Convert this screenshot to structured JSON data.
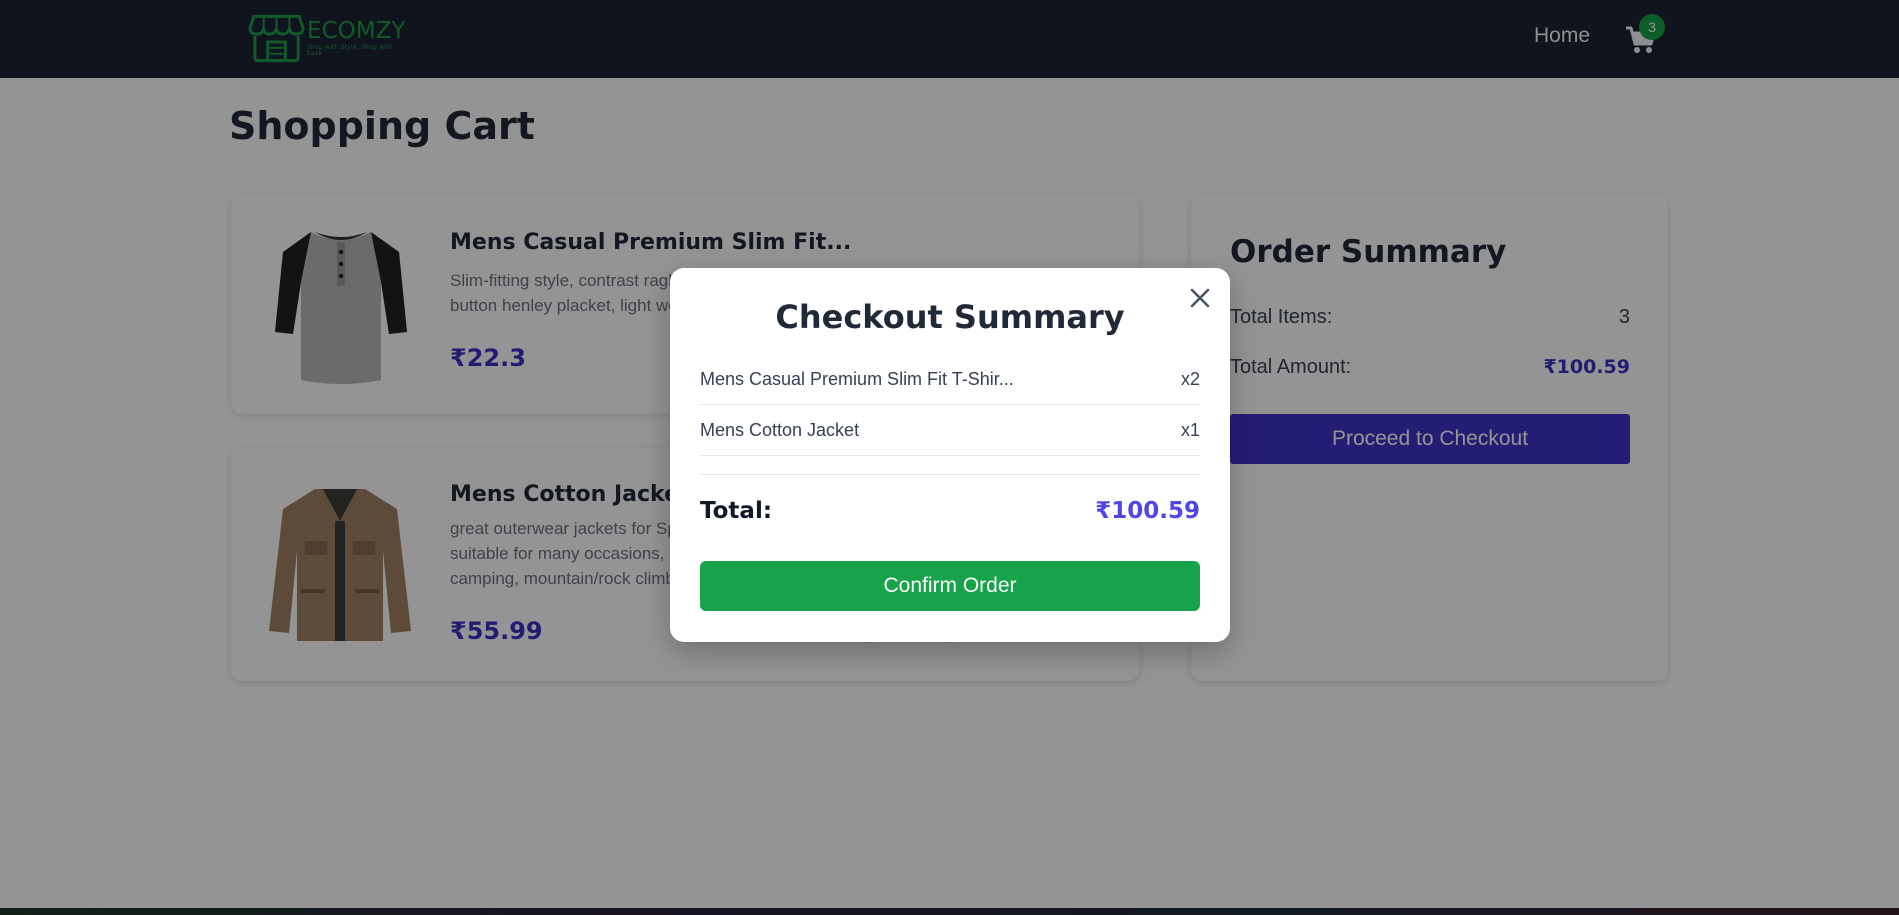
{
  "navbar": {
    "logo_text": "ECOMZY",
    "logo_tagline": "Shop with Style, Shop with Ease",
    "home_label": "Home",
    "cart_count": "3",
    "brand_color": "#1e9c4a"
  },
  "page": {
    "title": "Shopping Cart"
  },
  "cart_items": [
    {
      "name": "Mens Casual Premium Slim Fit...",
      "description": "Slim-fitting style, contrast raglan long sleeve, three-button henley placket, light weight",
      "price": "₹22.3",
      "image": "tshirt-image"
    },
    {
      "name": "Mens Cotton Jacket",
      "description": "great outerwear jackets for Spring/Autumn/Winter, suitable for many occasions, such as working, hiking, camping, mountain/rock climbing",
      "price": "₹55.99",
      "image": "jacket-image"
    }
  ],
  "order_summary": {
    "title": "Order Summary",
    "total_items_label": "Total Items:",
    "total_items_value": "3",
    "total_amount_label": "Total Amount:",
    "total_amount_value": "₹100.59",
    "proceed_label": "Proceed to Checkout"
  },
  "modal": {
    "title": "Checkout Summary",
    "items": [
      {
        "name": "Mens Casual Premium Slim Fit T-Shir...",
        "qty": "x2"
      },
      {
        "name": "Mens Cotton Jacket",
        "qty": "x1"
      }
    ],
    "total_label": "Total:",
    "total_value": "₹100.59",
    "confirm_label": "Confirm Order"
  },
  "colors": {
    "accent": "#3f33c9",
    "price": "#3b32c4",
    "confirm": "#16a34a",
    "navbar": "#1c2431"
  }
}
